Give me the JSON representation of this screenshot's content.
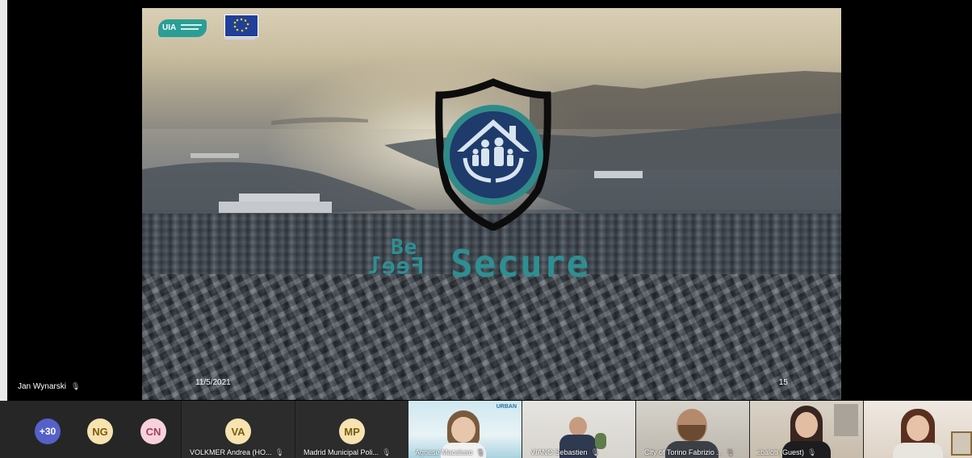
{
  "presenter": {
    "name": "Jan Wynarski"
  },
  "slide": {
    "brand_be": "Be",
    "brand_feel": "Feel",
    "brand_secure": "Secure",
    "date": "11/5/2021",
    "page": "15",
    "logo_uia": "UIA",
    "accent_color": "#2e8f93"
  },
  "participants": {
    "overflow_count": "+30",
    "avatars": [
      {
        "initials": "NG",
        "color": "#f6e3b0",
        "text_color": "#7a5a10"
      },
      {
        "initials": "CN",
        "color": "#f7d2dc",
        "text_color": "#a04060"
      }
    ],
    "tiles": [
      {
        "initials": "VA",
        "name": "VOLKMER Andrea (HO..."
      },
      {
        "initials": "MP",
        "name": "Madrid Municipal Poli..."
      }
    ],
    "video_tiles": [
      {
        "name": "Agnese Macaluso"
      },
      {
        "name": "VIANO Sebastien"
      },
      {
        "name": "City of Torino Fabrizio ..."
      },
      {
        "name": "ebaloti (Guest)"
      },
      {
        "name": ""
      }
    ],
    "urban_logo": "URBAN"
  }
}
